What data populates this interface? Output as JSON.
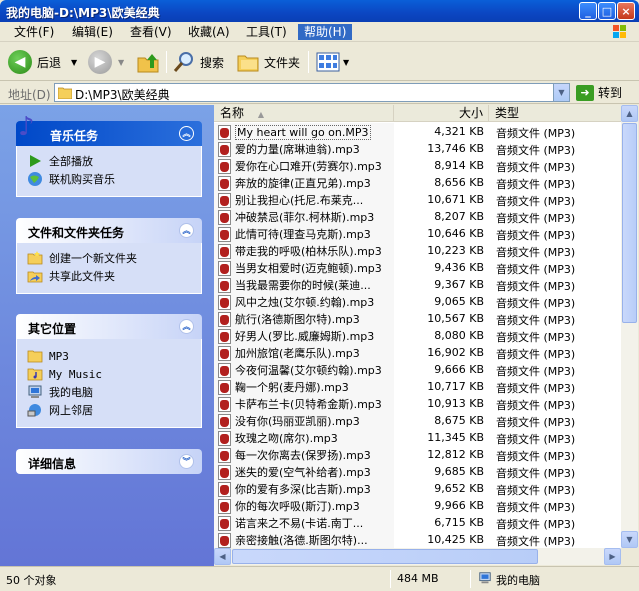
{
  "window": {
    "title": "我的电脑-D:\\MP3\\欧美经典",
    "controls": {
      "minimize": "_",
      "maximize": "□",
      "close": "×"
    }
  },
  "menu": [
    "文件(F)",
    "编辑(E)",
    "查看(V)",
    "收藏(A)",
    "工具(T)",
    "帮助(H)"
  ],
  "toolbar": {
    "back_label": "后退",
    "search_label": "搜索",
    "folders_label": "文件夹"
  },
  "address": {
    "label": "地址(D)",
    "value": "D:\\MP3\\欧美经典",
    "go_label": "转到"
  },
  "left_pane": {
    "music_tasks": {
      "title": "音乐任务",
      "items": [
        "全部播放",
        "联机购买音乐"
      ]
    },
    "file_tasks": {
      "title": "文件和文件夹任务",
      "items": [
        "创建一个新文件夹",
        "共享此文件夹"
      ]
    },
    "other_places": {
      "title": "其它位置",
      "items": [
        "MP3",
        "My Music",
        "我的电脑",
        "网上邻居"
      ]
    },
    "details": {
      "title": "详细信息"
    }
  },
  "columns": {
    "name": "名称",
    "size": "大小",
    "type": "类型"
  },
  "files": [
    {
      "name": "My heart will go on.MP3",
      "size": "4,321 KB",
      "type": "音频文件 (MP3)"
    },
    {
      "name": "爱的力量(席琳迪翁).mp3",
      "size": "13,746 KB",
      "type": "音频文件 (MP3)"
    },
    {
      "name": "爱你在心口难开(劳赛尔).mp3",
      "size": "8,914 KB",
      "type": "音频文件 (MP3)"
    },
    {
      "name": "奔放的旋律(正直兄弟).mp3",
      "size": "8,656 KB",
      "type": "音频文件 (MP3)"
    },
    {
      "name": "别让我担心(托尼.布莱克...",
      "size": "10,671 KB",
      "type": "音频文件 (MP3)"
    },
    {
      "name": "冲破禁忌(菲尔.柯林斯).mp3",
      "size": "8,207 KB",
      "type": "音频文件 (MP3)"
    },
    {
      "name": "此情可待(理查马克斯).mp3",
      "size": "10,646 KB",
      "type": "音频文件 (MP3)"
    },
    {
      "name": "带走我的呼吸(柏林乐队).mp3",
      "size": "10,223 KB",
      "type": "音频文件 (MP3)"
    },
    {
      "name": "当男女相爱时(迈克鲍顿).mp3",
      "size": "9,436 KB",
      "type": "音频文件 (MP3)"
    },
    {
      "name": "当我最需要你的时候(莱迪...",
      "size": "9,367 KB",
      "type": "音频文件 (MP3)"
    },
    {
      "name": "风中之烛(艾尔顿.约翰).mp3",
      "size": "9,065 KB",
      "type": "音频文件 (MP3)"
    },
    {
      "name": "航行(洛德斯图尔特).mp3",
      "size": "10,567 KB",
      "type": "音频文件 (MP3)"
    },
    {
      "name": "好男人(罗比.威廉姆斯).mp3",
      "size": "8,080 KB",
      "type": "音频文件 (MP3)"
    },
    {
      "name": "加州旅馆(老鹰乐队).mp3",
      "size": "16,902 KB",
      "type": "音频文件 (MP3)"
    },
    {
      "name": "今夜何温馨(艾尔顿约翰).mp3",
      "size": "9,666 KB",
      "type": "音频文件 (MP3)"
    },
    {
      "name": "鞠一个躬(麦丹娜).mp3",
      "size": "10,717 KB",
      "type": "音频文件 (MP3)"
    },
    {
      "name": "卡萨布兰卡(贝特希金斯).mp3",
      "size": "10,913 KB",
      "type": "音频文件 (MP3)"
    },
    {
      "name": "没有你(玛丽亚凯丽).mp3",
      "size": "8,675 KB",
      "type": "音频文件 (MP3)"
    },
    {
      "name": "玫瑰之吻(席尔).mp3",
      "size": "11,345 KB",
      "type": "音频文件 (MP3)"
    },
    {
      "name": "每一次你离去(保罗扬).mp3",
      "size": "12,812 KB",
      "type": "音频文件 (MP3)"
    },
    {
      "name": "迷失的爱(空气补给者).mp3",
      "size": "9,685 KB",
      "type": "音频文件 (MP3)"
    },
    {
      "name": "你的爱有多深(比吉斯).mp3",
      "size": "9,652 KB",
      "type": "音频文件 (MP3)"
    },
    {
      "name": "你的每次呼吸(斯汀).mp3",
      "size": "9,966 KB",
      "type": "音频文件 (MP3)"
    },
    {
      "name": "诺言来之不易(卡诺.南丁...",
      "size": "6,715 KB",
      "type": "音频文件 (MP3)"
    },
    {
      "name": "亲密接触(洛德.斯图尔特)...",
      "size": "10,425 KB",
      "type": "音频文件 (MP3)"
    }
  ],
  "status": {
    "count": "50 个对象",
    "size": "484 MB",
    "location": "我的电脑"
  },
  "icons": {
    "back": "arrow-left-icon",
    "forward": "arrow-right-icon",
    "up": "folder-up-icon",
    "search": "magnifier-icon",
    "folders": "folders-icon",
    "views": "views-grid-icon"
  },
  "colors": {
    "titlebar": "#0b46c2",
    "taskpane": "#6f8fe0",
    "accent_green": "#3a9d23",
    "selection": "#316ac5"
  }
}
